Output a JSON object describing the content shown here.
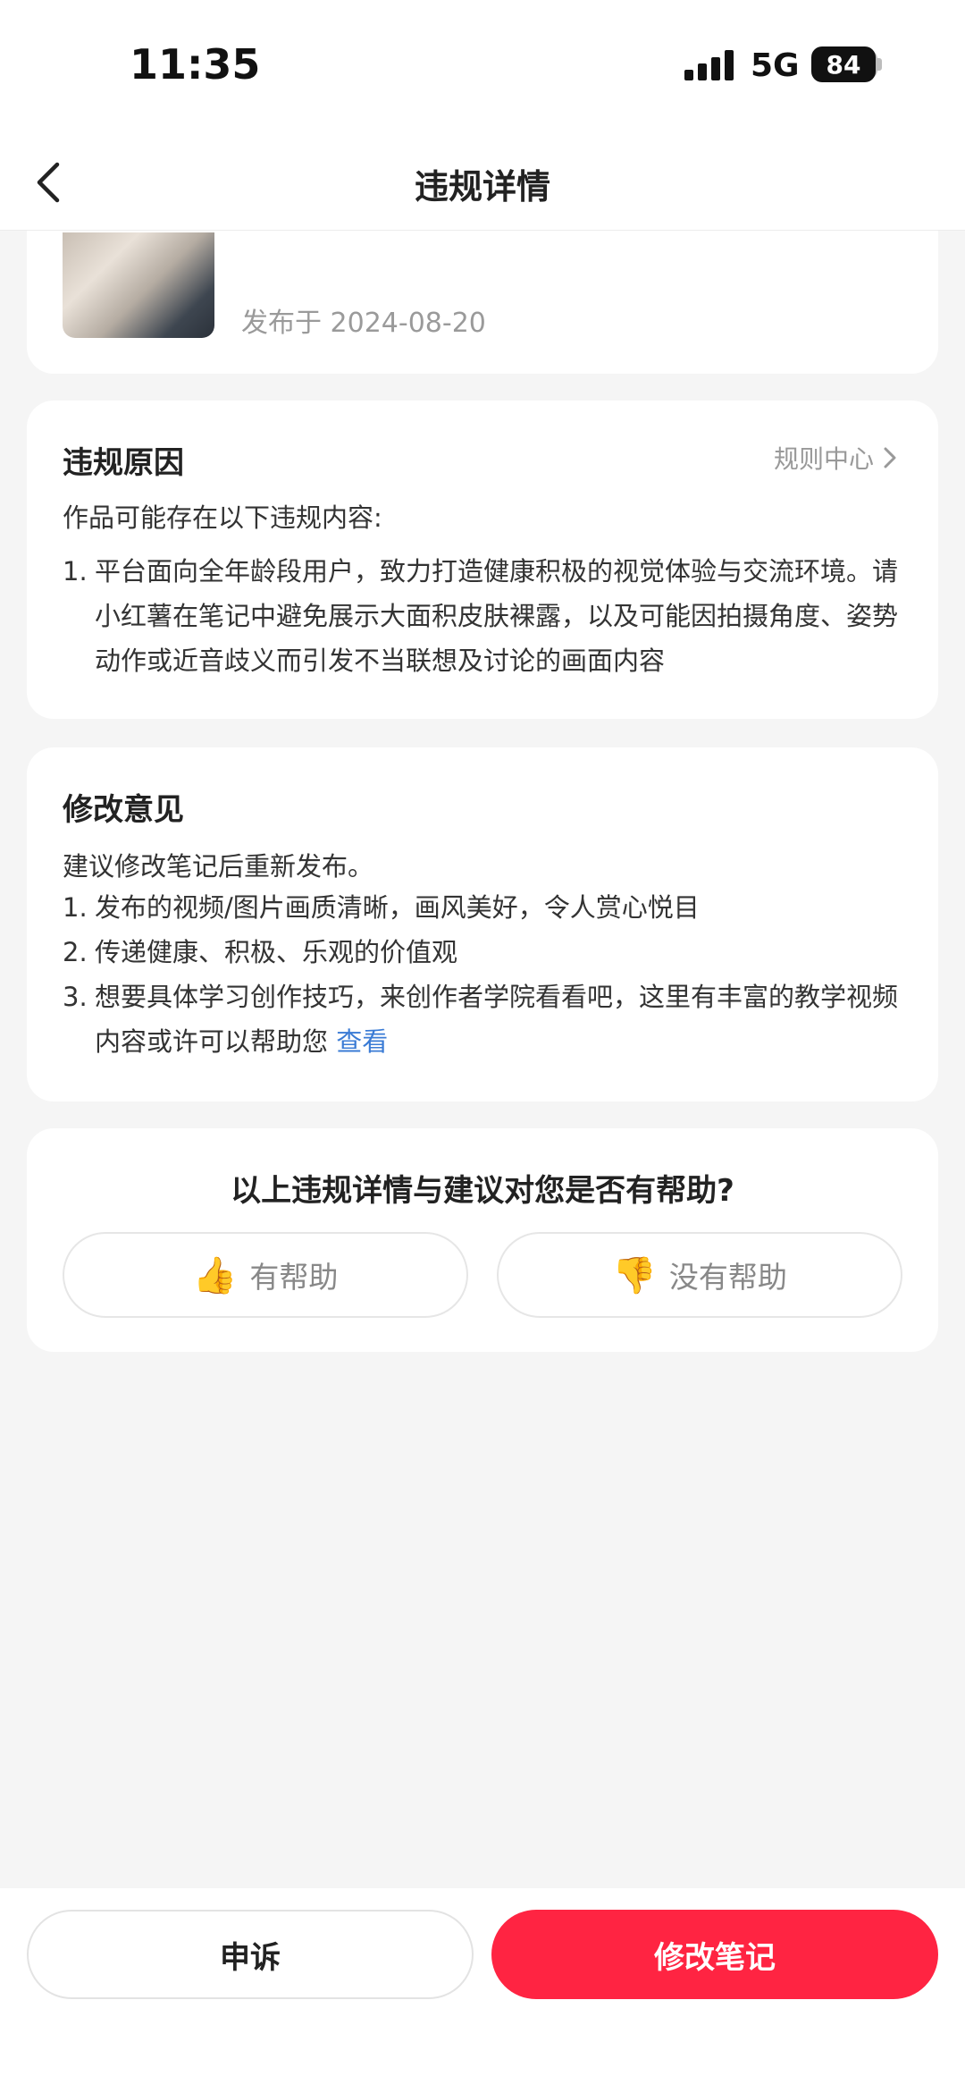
{
  "status_bar": {
    "time": "11:35",
    "network": "5G",
    "battery": "84"
  },
  "nav": {
    "title": "违规详情"
  },
  "post": {
    "date": "发布于 2024-08-20"
  },
  "violation": {
    "title": "违规原因",
    "rules_link": "规则中心",
    "intro": "作品可能存在以下违规内容:",
    "items": [
      {
        "num": "1.",
        "text": "平台面向全年龄段用户，致力打造健康积极的视觉体验与交流环境。请小红薯在笔记中避免展示大面积皮肤裸露，以及可能因拍摄角度、姿势动作或近音歧义而引发不当联想及讨论的画面内容"
      }
    ]
  },
  "suggestion": {
    "title": "修改意见",
    "intro": "建议修改笔记后重新发布。",
    "items": [
      {
        "num": "1.",
        "text": "发布的视频/图片画质清晰，画风美好，令人赏心悦目"
      },
      {
        "num": "2.",
        "text": "传递健康、积极、乐观的价值观"
      },
      {
        "num": "3.",
        "text": "想要具体学习创作技巧，来创作者学院看看吧，这里有丰富的教学视频内容或许可以帮助您",
        "link": "查看"
      }
    ]
  },
  "feedback": {
    "question": "以上违规详情与建议对您是否有帮助?",
    "helpful": {
      "emoji": "👍",
      "label": "有帮助"
    },
    "not_helpful": {
      "emoji": "👎",
      "label": "没有帮助"
    }
  },
  "actions": {
    "appeal": "申诉",
    "edit": "修改笔记"
  }
}
